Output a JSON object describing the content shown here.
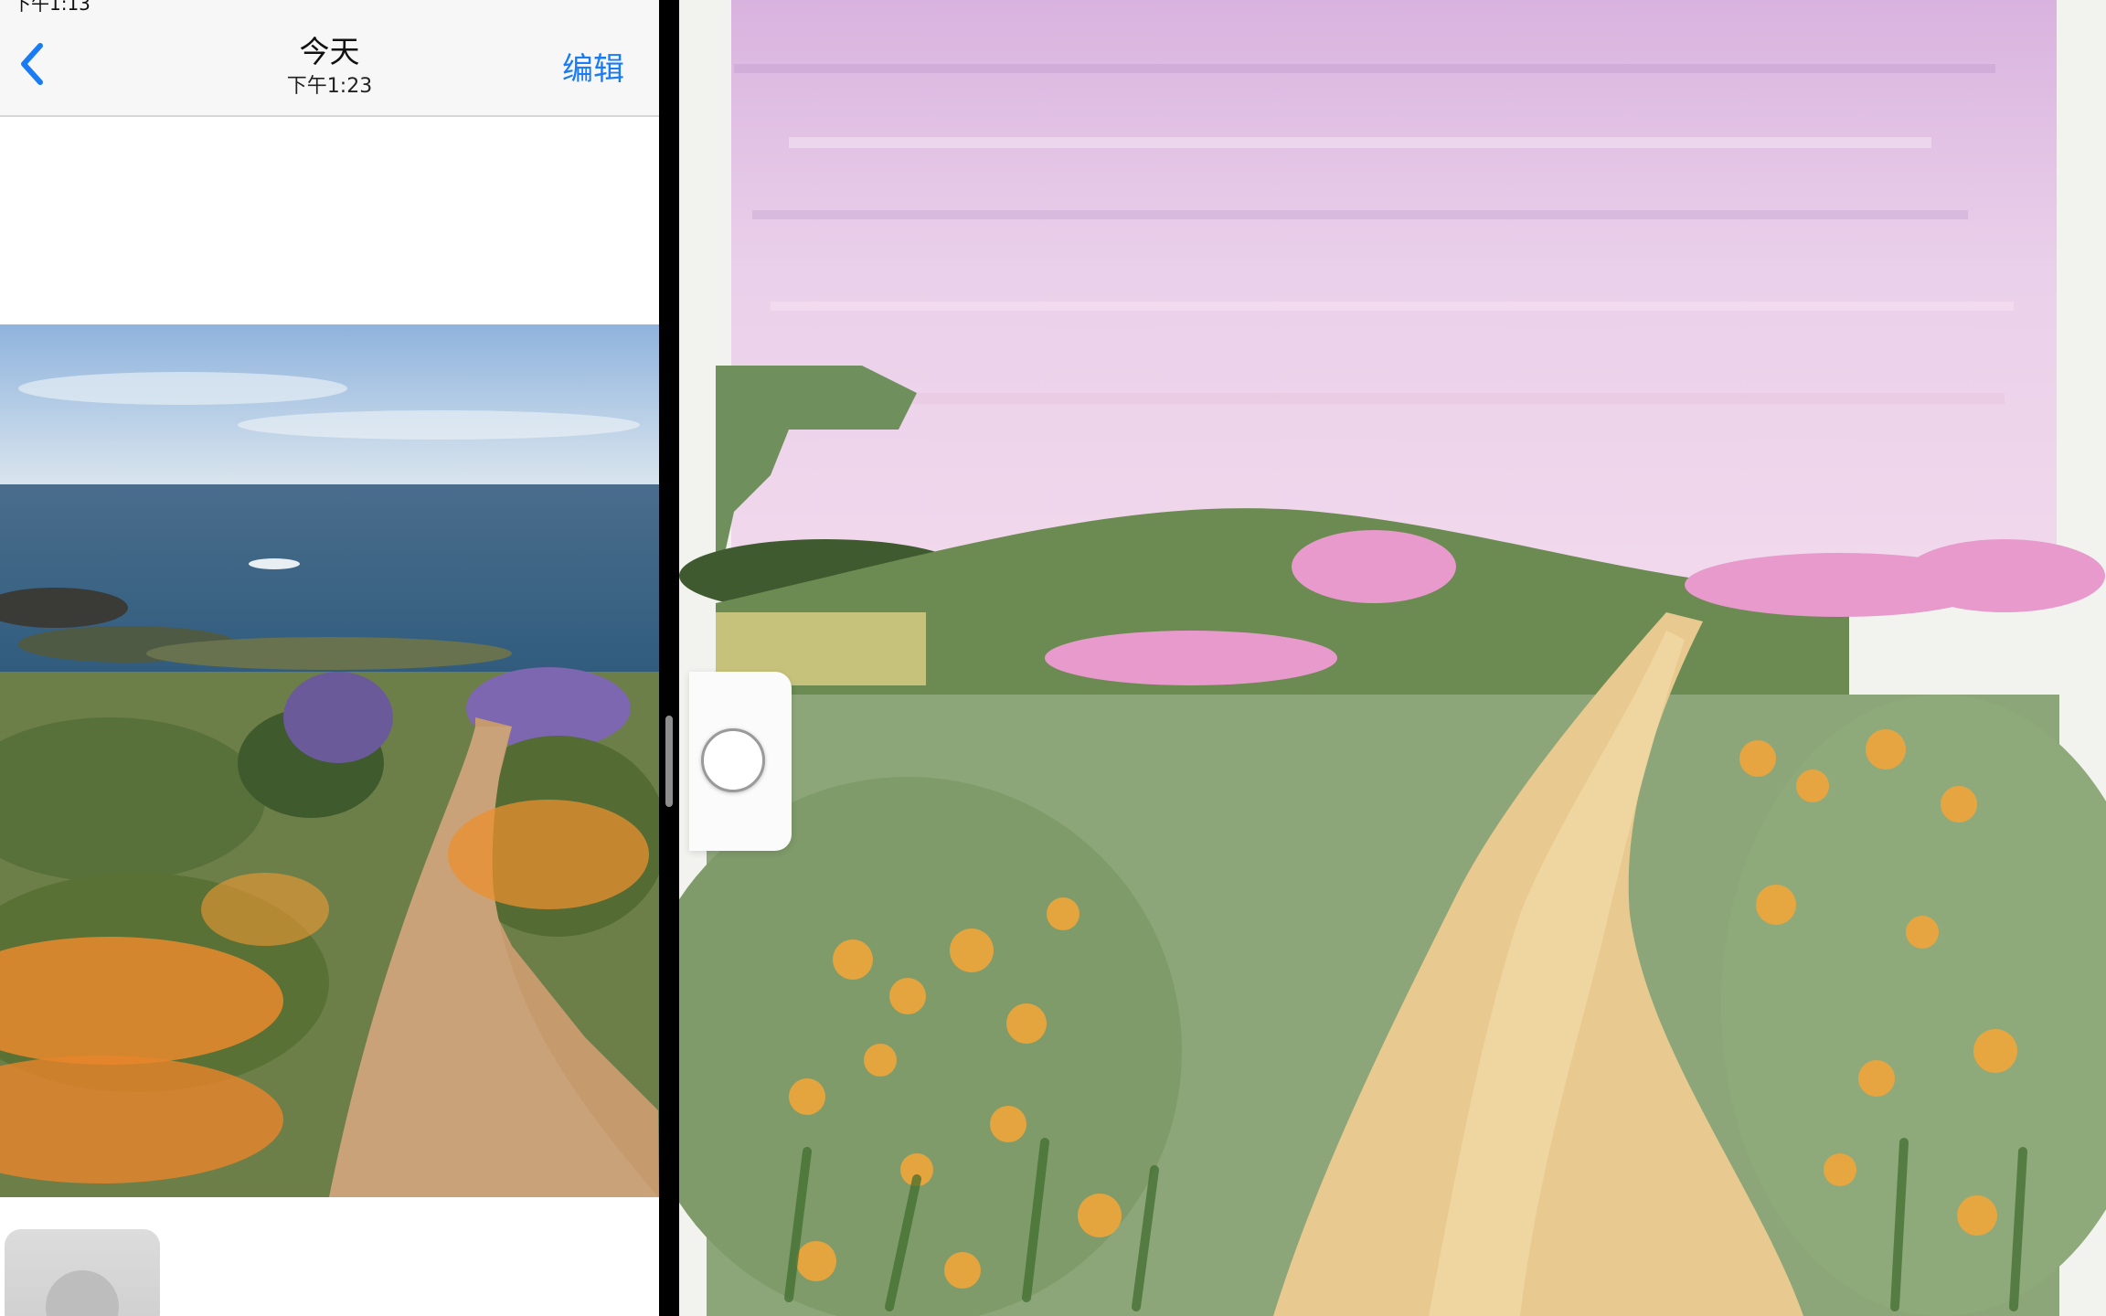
{
  "photos_app": {
    "status_bar": {
      "time_fragment": "下午1:13"
    },
    "nav": {
      "title": "今天",
      "subtitle": "下午1:23",
      "edit_label": "编辑",
      "accent_color": "#1a7cf5"
    },
    "icons": {
      "back": "chevron-left-icon"
    }
  },
  "painting_app": {
    "canvas_palette": {
      "sky": "#e9c8e6",
      "hills": "#6f8f5c",
      "path": "#e8c98f",
      "poppies": "#f0a53a",
      "lupine": "#d98cc0"
    },
    "controls": {
      "brush_size": "brush-size-circle"
    }
  }
}
